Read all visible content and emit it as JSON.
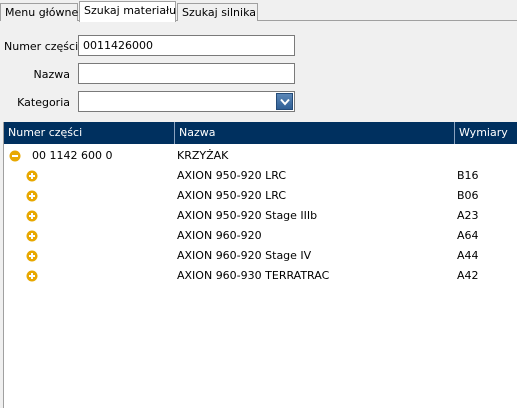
{
  "tabs": [
    {
      "label": "Menu główne",
      "active": false
    },
    {
      "label": "Szukaj materiału",
      "active": true
    },
    {
      "label": "Szukaj silnika",
      "active": false
    }
  ],
  "form": {
    "part_number_label": "Numer części",
    "part_number_value": "0011426000",
    "name_label": "Nazwa",
    "name_value": "",
    "category_label": "Kategoria",
    "category_value": ""
  },
  "table": {
    "columns": [
      "Numer części",
      "Nazwa",
      "Wymiary"
    ],
    "rows": [
      {
        "icon": "collapse-icon",
        "part": "00 1142 600 0",
        "name": "KRZYŻAK",
        "dim": ""
      },
      {
        "icon": "expand-icon",
        "part": "",
        "name": "AXION 950-920 LRC",
        "dim": "B16"
      },
      {
        "icon": "expand-icon",
        "part": "",
        "name": "AXION 950-920 LRC",
        "dim": "B06"
      },
      {
        "icon": "expand-icon",
        "part": "",
        "name": "AXION 950-920 Stage IIIb",
        "dim": "A23"
      },
      {
        "icon": "expand-icon",
        "part": "",
        "name": "AXION 960-920",
        "dim": "A64"
      },
      {
        "icon": "expand-icon",
        "part": "",
        "name": "AXION 960-920 Stage IV",
        "dim": "A44"
      },
      {
        "icon": "expand-icon",
        "part": "",
        "name": "AXION 960-930 TERRATRAC",
        "dim": "A42"
      }
    ]
  },
  "colors": {
    "header_bg": "#00305f",
    "expand_icon": "#e8a800",
    "combo_button": "#3a6ea5"
  }
}
